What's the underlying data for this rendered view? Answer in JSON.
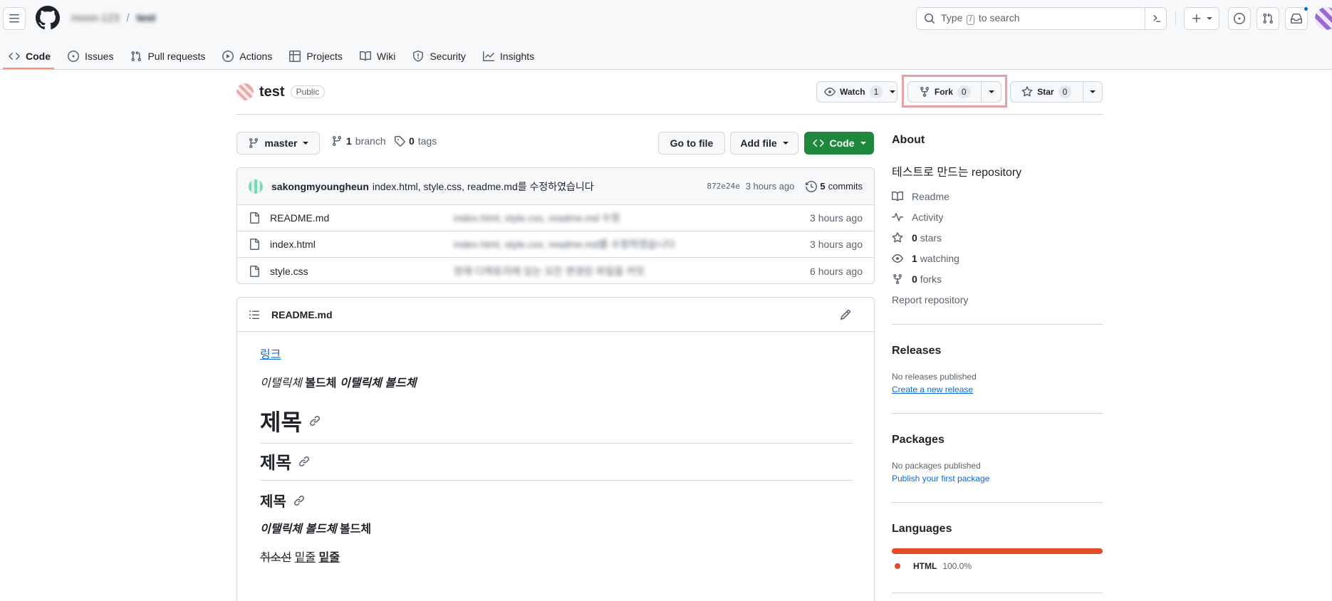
{
  "header": {
    "owner": "moon-123",
    "repo": "test",
    "search_prefix": "Type",
    "search_key": "/",
    "search_suffix": "to search"
  },
  "nav": {
    "code": "Code",
    "issues": "Issues",
    "pulls": "Pull requests",
    "actions": "Actions",
    "projects": "Projects",
    "wiki": "Wiki",
    "security": "Security",
    "insights": "Insights"
  },
  "repo": {
    "name": "test",
    "visibility": "Public",
    "watch_label": "Watch",
    "watch_count": "1",
    "fork_label": "Fork",
    "fork_count": "0",
    "star_label": "Star",
    "star_count": "0"
  },
  "branchbar": {
    "branch": "master",
    "branch_count": "1",
    "branch_word": "branch",
    "tag_count": "0",
    "tag_word": "tags",
    "goto_file": "Go to file",
    "add_file": "Add file",
    "code": "Code"
  },
  "commit": {
    "author": "sakongmyoungheun",
    "message": "index.html, style.css, readme.md를 수정하였습니다",
    "hash": "872e24e",
    "time": "3 hours ago",
    "count": "5",
    "count_word": "commits"
  },
  "files": [
    {
      "name": "README.md",
      "message": "index.html, style.css, readme.md 수정",
      "age": "3 hours ago"
    },
    {
      "name": "index.html",
      "message": "index.html, style.css, readme.md를 수정하였습니다",
      "age": "3 hours ago"
    },
    {
      "name": "style.css",
      "message": "현재 디렉토리에 있는 모든 변경된 파일을 커밋",
      "age": "6 hours ago"
    }
  ],
  "readme": {
    "filename": "README.md",
    "link": "링크",
    "line1_italic": "이탤릭체",
    "line1_bold": "볼드체",
    "line1_bolditalic": "이탤릭체 볼드체",
    "h1": "제목",
    "h2": "제목",
    "h3": "제목",
    "line2_bolditalic": "이탤릭체 볼드체",
    "line2_bold": "볼드체",
    "strike": "취소선",
    "underline": "밑줄",
    "underline_bold": "밑줄"
  },
  "about": {
    "title": "About",
    "description": "테스트로 만드는 repository",
    "readme": "Readme",
    "activity": "Activity",
    "stars_count": "0",
    "stars_word": "stars",
    "watching_count": "1",
    "watching_word": "watching",
    "forks_count": "0",
    "forks_word": "forks",
    "report": "Report repository"
  },
  "releases": {
    "title": "Releases",
    "empty": "No releases published",
    "create": "Create a new release"
  },
  "packages": {
    "title": "Packages",
    "empty": "No packages published",
    "publish": "Publish your first package"
  },
  "languages": {
    "title": "Languages",
    "items": [
      {
        "name": "HTML",
        "percent": "100.0%",
        "color": "#e34c26"
      }
    ]
  }
}
